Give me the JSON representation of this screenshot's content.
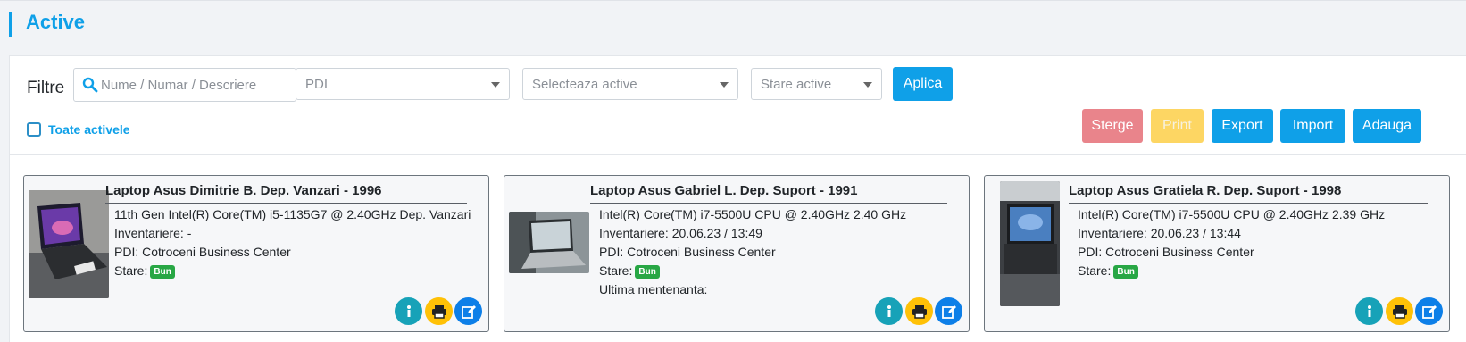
{
  "page": {
    "title": "Active"
  },
  "filters": {
    "label": "Filtre",
    "search_placeholder": "Nume / Numar / Descriere",
    "pdi_select": "PDI",
    "assets_select": "Selecteaza active",
    "status_select": "Stare active",
    "apply_label": "Aplica",
    "all_assets_label": "Toate activele"
  },
  "actions": {
    "delete_label": "Sterge",
    "print_label": "Print",
    "export_label": "Export",
    "import_label": "Import",
    "add_label": "Adauga"
  },
  "assets": [
    {
      "title": "Laptop Asus Dimitrie B. Dep. Vanzari - 1996",
      "description": "11th Gen Intel(R) Core(TM) i5-1135G7 @ 2.40GHz Dep. Vanzari",
      "inventory": "Inventariere: -",
      "pdi": "PDI: Cotroceni Business Center",
      "status_label": "Stare:",
      "status_badge": "Bun"
    },
    {
      "title": "Laptop Asus Gabriel L. Dep. Suport - 1991",
      "description": "Intel(R) Core(TM) i7-5500U CPU @ 2.40GHz 2.40 GHz",
      "inventory": "Inventariere: 20.06.23 / 13:49",
      "pdi": "PDI: Cotroceni Business Center",
      "status_label": "Stare:",
      "status_badge": "Bun",
      "maintenance": "Ultima mentenanta:"
    },
    {
      "title": "Laptop Asus Gratiela R. Dep. Suport - 1998",
      "description": "Intel(R) Core(TM) i7-5500U CPU @ 2.40GHz 2.39 GHz",
      "inventory": "Inventariere: 20.06.23 / 13:44",
      "pdi": "PDI: Cotroceni Business Center",
      "status_label": "Stare:",
      "status_badge": "Bun"
    }
  ],
  "colors": {
    "accent": "#0fa0e8",
    "danger": "#e9848b",
    "warning": "#fdd663",
    "success": "#28a745",
    "info": "#17a2b8",
    "print_round": "#ffc107",
    "edit_round": "#0d7fe8"
  },
  "icons": [
    "search-icon",
    "chevron-down-icon",
    "info-icon",
    "print-icon",
    "edit-icon",
    "laptop-photo"
  ]
}
